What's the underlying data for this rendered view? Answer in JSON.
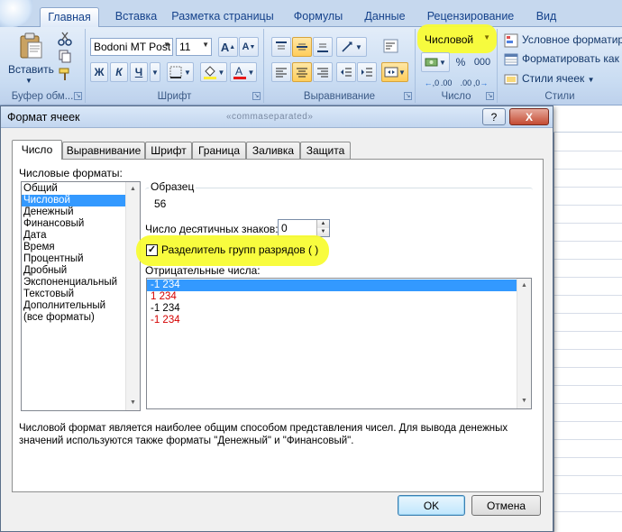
{
  "ribbon": {
    "tabs": [
      "Главная",
      "Вставка",
      "Разметка страницы",
      "Формулы",
      "Данные",
      "Рецензирование",
      "Вид"
    ],
    "active_tab": "Главная",
    "clipboard": {
      "paste_label": "Вставить",
      "group_label": "Буфер обм..."
    },
    "font": {
      "name": "Bodoni MT Post",
      "size": "11",
      "group_label": "Шрифт",
      "bold": "Ж",
      "italic": "К",
      "underline": "Ч",
      "grow": "A",
      "shrink": "A"
    },
    "alignment": {
      "group_label": "Выравнивание"
    },
    "number": {
      "format": "Числовой",
      "group_label": "Число",
      "percent": "%",
      "thousands": "000",
      "inc_dec": ",0 .00",
      "dec_dec": ".00 ,0"
    },
    "styles": {
      "conditional": "Условное форматир",
      "format_table": "Форматировать как",
      "cell_styles": "Стили ячеек",
      "group_label": "Стили"
    },
    "colors": {
      "highlight": "#f8fc34",
      "font_color": "#e81818",
      "fill_color": "#ffee33"
    }
  },
  "dialog": {
    "title": "Формат ячеек",
    "ghost_title": "«commaseparated»",
    "help": "?",
    "close": "X",
    "tabs": [
      "Число",
      "Выравнивание",
      "Шрифт",
      "Граница",
      "Заливка",
      "Защита"
    ],
    "active_tab": "Число",
    "formats_label": "Числовые форматы:",
    "formats": [
      "Общий",
      "Числовой",
      "Денежный",
      "Финансовый",
      "Дата",
      "Время",
      "Процентный",
      "Дробный",
      "Экспоненциальный",
      "Текстовый",
      "Дополнительный",
      "(все форматы)"
    ],
    "selected_format": "Числовой",
    "sample_label": "Образец",
    "sample_value": "56",
    "decimals_label": "Число десятичных знаков:",
    "decimals_value": "0",
    "separator_label": "Разделитель групп разрядов ( )",
    "separator_checked": true,
    "negative_label": "Отрицательные числа:",
    "negative_options": [
      {
        "text": "-1 234",
        "color": "#000000"
      },
      {
        "text": "1 234",
        "color": "#d40000"
      },
      {
        "text": "-1 234",
        "color": "#000000"
      },
      {
        "text": "-1 234",
        "color": "#d40000"
      }
    ],
    "description": "Числовой формат является наиболее общим способом представления чисел. Для вывода денежных значений используются также форматы \"Денежный\" и \"Финансовый\".",
    "ok_label": "OK",
    "cancel_label": "Отмена"
  }
}
